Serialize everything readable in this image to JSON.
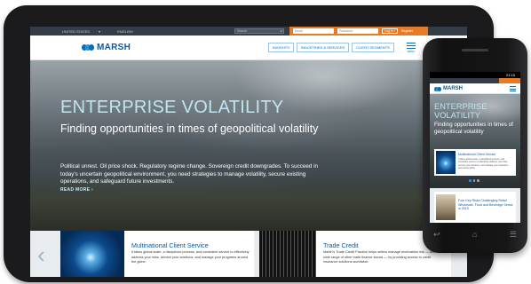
{
  "tablet": {
    "utility": {
      "country": "UNITED STATES",
      "language": "ENGLISH",
      "search_placeholder": "Search",
      "email_placeholder": "Email",
      "password_placeholder": "Password",
      "login_label": "Log in",
      "register_label": "Register"
    },
    "logo_text": "MARSH",
    "nav": {
      "items": [
        "INSIGHTS",
        "INDUSTRIES & SERVICES",
        "CLIENT SEGMENTS"
      ],
      "menu_label": "MENU"
    },
    "hero": {
      "title": "ENTERPRISE VOLATILITY",
      "subtitle": "Finding opportunities in times of geopolitical volatility",
      "body": "Political unrest. Oil price shock. Regulatory regime change. Sovereign credit downgrades. To succeed in today's uncertain geopolitical environment, you need strategies to manage volatility, secure existing operations, and safeguard future investments.",
      "read_more": "READ MORE"
    },
    "cards": [
      {
        "title": "Multinational Client Service",
        "text": "It takes global scale, a disciplined process, and consistent service to effectively address your risks, service your solutions, and manage your programs around the globe."
      },
      {
        "title": "Trade Credit",
        "text": "Marsh's Trade Credit Practice helps sellers manage receivables risk — and a wide range of other trade finance issues — by providing access to credit insurance solutions worldwide."
      }
    ]
  },
  "phone": {
    "status_time": "21:15",
    "logo_text": "MARSH",
    "hero_title": "ENTERPRISE VOLATILITY",
    "hero_subtitle": "Finding opportunities in times of geopolitical volatility",
    "card1_title": "Multinational Client Service",
    "card1_text": "It takes global scale, a disciplined process, and consistent service to effectively address your risks, service your solutions, and manage your programs around the globe.",
    "card2_title": "Four Key Risks Challenging Retail Wholesale, Food and Beverage Sector in 2015",
    "keys": [
      "↩",
      "⌂",
      "☰"
    ]
  }
}
